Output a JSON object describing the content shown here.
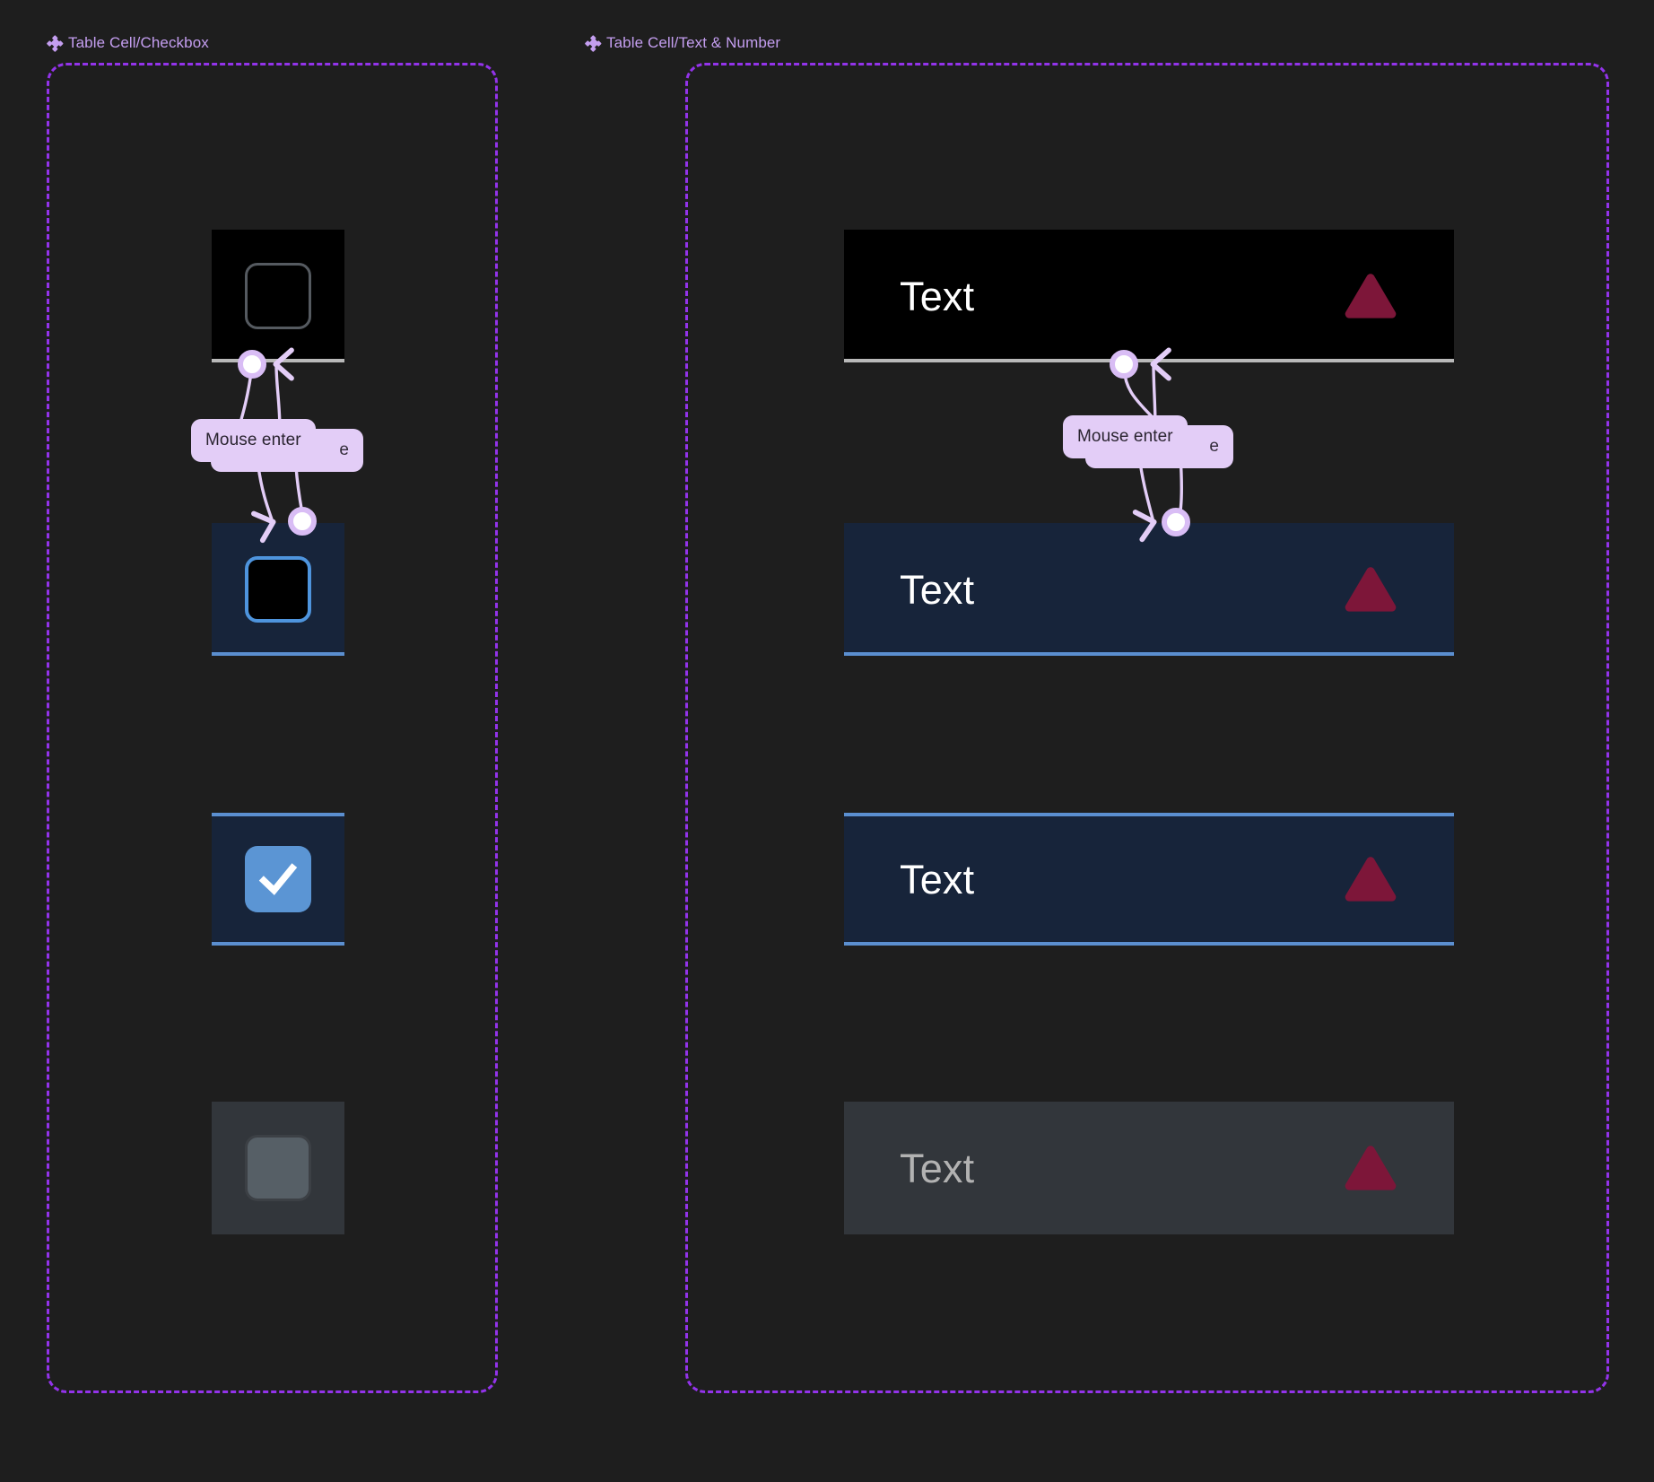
{
  "page": {
    "background_color": "#1e1e1e",
    "accent_purple": "#9333ea",
    "label_purple": "#c49ef0",
    "pill_lavender": "#e3cdf7",
    "focus_blue": "#5b8fd0",
    "checkbox_blue": "#5b95d4",
    "triangle_crimson": "#7d1639",
    "navy_cell": "#17243a",
    "gray_cell": "#32363b",
    "disabled_text": "#b2b2b2"
  },
  "frames": [
    {
      "id": "checkbox-frame",
      "label": "Table Cell/Checkbox",
      "icon": "component-diamond-icon"
    },
    {
      "id": "text-number-frame",
      "label": "Table Cell/Text & Number",
      "icon": "component-diamond-icon"
    }
  ],
  "checkbox_cells": [
    {
      "state": "default",
      "background": "#000000",
      "border_bottom": "#b9b9b9",
      "checked": false,
      "icon": "checkbox-unchecked-icon"
    },
    {
      "state": "hover",
      "background": "#17243a",
      "border_bottom": "#5b8fd0",
      "checked": false,
      "icon": "checkbox-unchecked-icon"
    },
    {
      "state": "checked",
      "background": "#17243a",
      "border_bottom": "#5b8fd0",
      "checked": true,
      "icon": "checkbox-checked-icon"
    },
    {
      "state": "disabled",
      "background": "#32363b",
      "border_bottom": "none",
      "checked": false,
      "icon": "checkbox-disabled-icon"
    }
  ],
  "text_cells": [
    {
      "state": "default",
      "text": "Text",
      "background": "#000000",
      "text_color": "#ffffff",
      "border_bottom": "#b9b9b9",
      "icon": "warning-triangle-icon"
    },
    {
      "state": "hover",
      "text": "Text",
      "background": "#17243a",
      "text_color": "#ffffff",
      "border_bottom": "#5b8fd0",
      "icon": "warning-triangle-icon"
    },
    {
      "state": "selected",
      "text": "Text",
      "background": "#17243a",
      "text_color": "#ffffff",
      "border_bottom": "#5b8fd0",
      "icon": "warning-triangle-icon"
    },
    {
      "state": "disabled",
      "text": "Text",
      "background": "#32363b",
      "text_color": "#b2b2b2",
      "border_bottom": "none",
      "icon": "warning-triangle-icon"
    }
  ],
  "interactions": [
    {
      "id": "checkbox-interaction",
      "front_label": "Mouse enter",
      "back_label": "e"
    },
    {
      "id": "text-interaction",
      "front_label": "Mouse enter",
      "back_label": "e"
    }
  ]
}
